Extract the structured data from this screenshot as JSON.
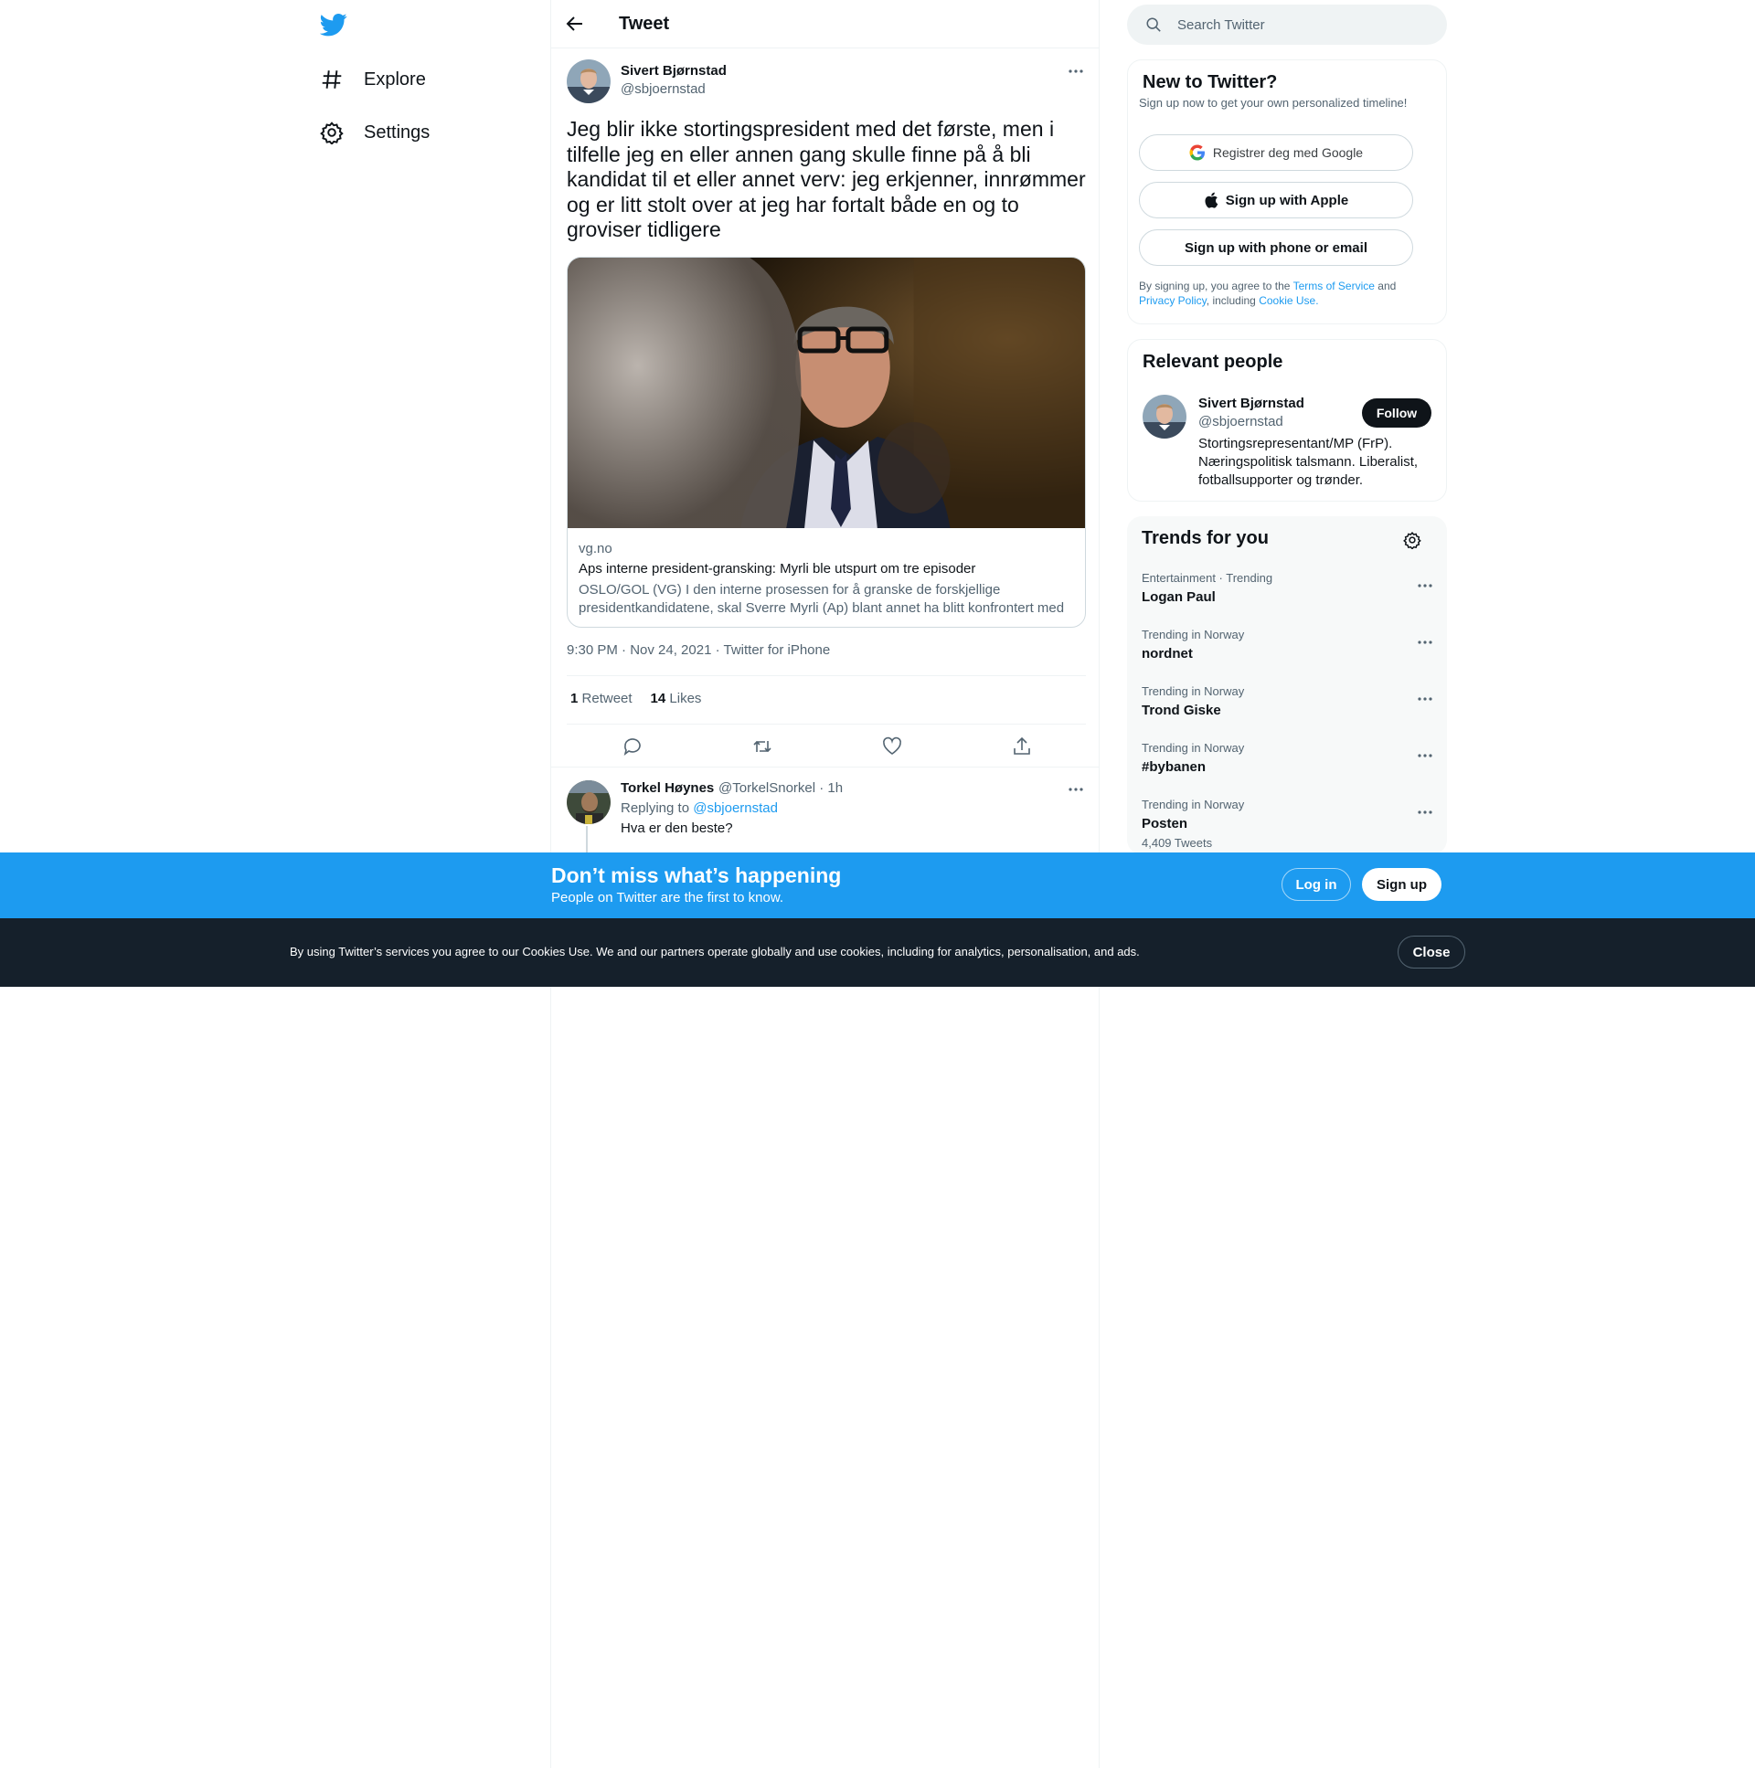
{
  "nav": {
    "logo_icon": "twitter-bird-icon",
    "items": [
      {
        "label": "Explore",
        "icon": "hashtag-icon"
      },
      {
        "label": "Settings",
        "icon": "gear-icon"
      }
    ]
  },
  "header": {
    "title": "Tweet"
  },
  "tweet": {
    "author_name": "Sivert Bjørnstad",
    "author_handle": "@sbjoernstad",
    "text": "Jeg blir ikke stortingspresident med det første, men i tilfelle jeg en eller annen gang skulle finne på å bli kandidat til et eller annet verv: jeg erkjenner, innrømmer og er litt stolt over at jeg har fortalt både en og to groviser tidligere",
    "card": {
      "domain": "vg.no",
      "title": "Aps interne president-gransking: Myrli ble utspurt om tre episoder",
      "description_line1": "OSLO/GOL (VG) I den interne prosessen for å granske de forskjellige",
      "description_line2": "presidentkandidatene, skal Sverre Myrli (Ap) blant annet ha blitt konfrontert med"
    },
    "meta": "9:30 PM · Nov 24, 2021 · Twitter for iPhone",
    "retweets_count": "1",
    "retweets_label": "Retweet",
    "likes_count": "14",
    "likes_label": "Likes",
    "actions": [
      "reply-icon",
      "retweet-icon",
      "like-icon",
      "share-icon"
    ]
  },
  "reply": {
    "author_name": "Torkel Høynes",
    "author_handle": "@TorkelSnorkel · 1h",
    "replying_prefix": "Replying to",
    "replying_to": "@sbjoernstad",
    "text": "Hva er den beste?"
  },
  "search": {
    "placeholder": "Search Twitter"
  },
  "new_to_twitter": {
    "title": "New to Twitter?",
    "subtitle": "Sign up now to get your own personalized timeline!",
    "google_label": "Registrer deg med Google",
    "apple_label": "Sign up with Apple",
    "phone_label": "Sign up with phone or email",
    "legal_prefix": "By signing up, you agree to the",
    "terms_link": "Terms of Service",
    "and": "and",
    "privacy_link": "Privacy Policy",
    "including": ", including",
    "cookie_link": "Cookie Use."
  },
  "relevant_people": {
    "title": "Relevant people",
    "name": "Sivert Bjørnstad",
    "handle": "@sbjoernstad",
    "follow_label": "Follow",
    "bio": "Stortingsrepresentant/MP (FrP). Næringspolitisk talsmann. Liberalist, fotballsupporter og trønder."
  },
  "trends": {
    "title": "Trends for you",
    "items": [
      {
        "category": "Entertainment · Trending",
        "name": "Logan Paul",
        "count": ""
      },
      {
        "category": "Trending in Norway",
        "name": "nordnet",
        "count": ""
      },
      {
        "category": "Trending in Norway",
        "name": "Trond Giske",
        "count": ""
      },
      {
        "category": "Trending in Norway",
        "name": "#bybanen",
        "count": ""
      },
      {
        "category": "Trending in Norway",
        "name": "Posten",
        "count": "4,409 Tweets"
      }
    ]
  },
  "banner": {
    "title": "Don’t miss what’s happening",
    "subtitle": "People on Twitter are the first to know.",
    "login_label": "Log in",
    "signup_label": "Sign up"
  },
  "cookie": {
    "text": "By using Twitter’s services you agree to our Cookies Use. We and our partners operate globally and use cookies, including for analytics, personalisation, and ads.",
    "close_label": "Close"
  },
  "colors": {
    "accent": "#1d9bf0",
    "text": "#0f1419",
    "muted": "#536471",
    "cookie_bg": "#15202b"
  }
}
